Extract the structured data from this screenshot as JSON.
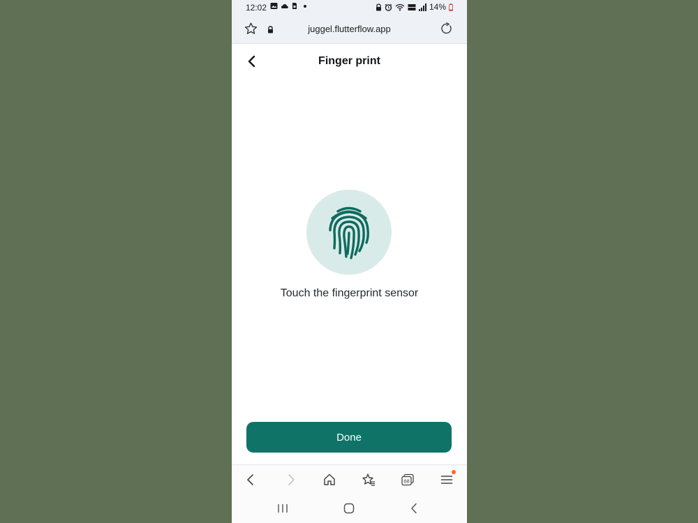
{
  "status_bar": {
    "time": "12:02",
    "left_icons": [
      "gallery-icon",
      "cloud-icon",
      "sim-icon",
      "dot-icon"
    ],
    "right_icons": [
      "lock-icon",
      "alarm-icon",
      "wifi-icon",
      "volte-icon",
      "signal-icon"
    ],
    "battery": "14%"
  },
  "browser": {
    "url": "juggel.flutterflow.app"
  },
  "header": {
    "title": "Finger print"
  },
  "main": {
    "instruction": "Touch the fingerprint sensor",
    "done_label": "Done"
  },
  "browser_nav": {
    "tabs_count": "68"
  },
  "colors": {
    "page_background": "#5f7054",
    "accent": "#0f7368",
    "fingerprint_circle": "#d9ebe8",
    "menu_badge": "#ff6a13"
  }
}
